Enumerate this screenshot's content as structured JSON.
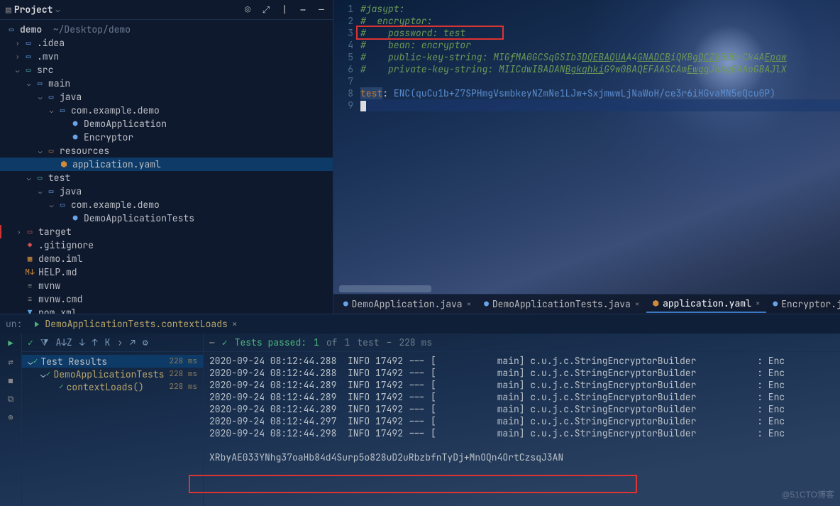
{
  "header": {
    "title": "Project"
  },
  "tree": {
    "root": {
      "name": "demo",
      "path": "~/Desktop/demo"
    },
    "idea": ".idea",
    "mvn": ".mvn",
    "src": "src",
    "main": "main",
    "java": "java",
    "pkg": "com.example.demo",
    "cls1": "DemoApplication",
    "cls2": "Encryptor",
    "resources": "resources",
    "appyaml": "application.yaml",
    "test": "test",
    "java2": "java",
    "pkg2": "com.example.demo",
    "cls3": "DemoApplicationTests",
    "target": "target",
    "gitignore": ".gitignore",
    "demoiml": "demo.iml",
    "help": "HELP.md",
    "mvnw": "mvnw",
    "mvnwcmd": "mvnw.cmd",
    "pom": "pom.xml"
  },
  "code": {
    "l1": "#jasypt:",
    "l2": "#  encryptor:",
    "l3": "#    password: test",
    "l4": "#    bean: encryptor",
    "l5a": "#    public-key-string: MIGfMA0GCSqGSIb3",
    "l5b": "DQEBAQUA",
    "l5c": "A4",
    "l5d": "GNADCB",
    "l5e": "iQKBg",
    "l5f": "QCZV",
    "l5g": "5U0+Ck4A",
    "l5h": "Epaw",
    "l6a": "#    private-key-string: MIICdwIBADAN",
    "l6b": "Bgkqhki",
    "l6c": "G9w0BAQEFAASCAm",
    "l6d": "Ewgg",
    "l6e": "JdAgEAAoGBAJlX",
    "l8k": "test",
    "l8c": ": ",
    "l8v": "ENC(quCu1b+Z7SPHmgVsmbkeyNZmNe1LJw+SxjmwwLjNaWoH/ce3r6iHGvaMN5eQcu0P)"
  },
  "tabs": {
    "t1": "DemoApplication.java",
    "t2": "DemoApplicationTests.java",
    "t3": "application.yaml",
    "t4": "Encryptor.java"
  },
  "run": {
    "label_prefix": "un:",
    "config": "DemoApplicationTests.contextLoads"
  },
  "tests": {
    "header": "Tests passed:",
    "count": "1",
    "of": " of ",
    "total": "1",
    "word": " test",
    "dash": " – ",
    "time": "228 ms",
    "root": "Test Results",
    "cls": "DemoApplicationTests",
    "m1": "contextLoads()",
    "ms": "228 ms"
  },
  "log": {
    "rows": [
      "2020-09-24 08:12:44.288  INFO 17492 --- [           main] c.u.j.c.StringEncryptorBuilder           : Enc",
      "2020-09-24 08:12:44.288  INFO 17492 --- [           main] c.u.j.c.StringEncryptorBuilder           : Enc",
      "2020-09-24 08:12:44.289  INFO 17492 --- [           main] c.u.j.c.StringEncryptorBuilder           : Enc",
      "2020-09-24 08:12:44.289  INFO 17492 --- [           main] c.u.j.c.StringEncryptorBuilder           : Enc",
      "2020-09-24 08:12:44.289  INFO 17492 --- [           main] c.u.j.c.StringEncryptorBuilder           : Enc",
      "2020-09-24 08:12:44.297  INFO 17492 --- [           main] c.u.j.c.StringEncryptorBuilder           : Enc",
      "2020-09-24 08:12:44.298  INFO 17492 --- [           main] c.u.j.c.StringEncryptorBuilder           : Enc",
      "",
      "XRbyAE033YNhg37oaHb84d4Surp5o828uD2uRbzbfnTyDj+MnOQn4OrtCzsqJ3AN"
    ]
  },
  "watermark": "@51CTO博客"
}
